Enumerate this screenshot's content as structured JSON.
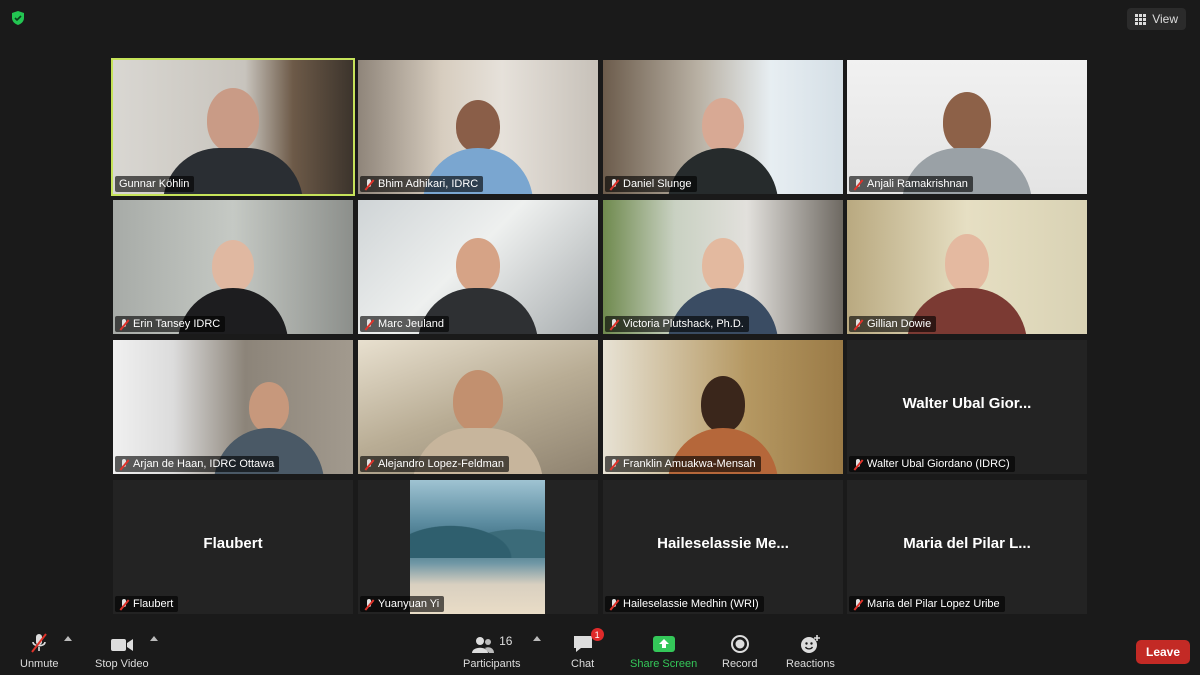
{
  "top": {
    "view_label": "View"
  },
  "tiles": [
    {
      "name": "Gunnar Köhlin",
      "muted": false,
      "video": true,
      "active": true
    },
    {
      "name": "Bhim Adhikari, IDRC",
      "muted": true,
      "video": true
    },
    {
      "name": "Daniel Slunge",
      "muted": true,
      "video": true
    },
    {
      "name": "Anjali Ramakrishnan",
      "muted": true,
      "video": true
    },
    {
      "name": "Erin Tansey IDRC",
      "muted": true,
      "video": true
    },
    {
      "name": "Marc Jeuland",
      "muted": true,
      "video": true
    },
    {
      "name": "Victoria Plutshack, Ph.D.",
      "muted": true,
      "video": true
    },
    {
      "name": "Gillian Dowie",
      "muted": true,
      "video": true
    },
    {
      "name": "Arjan de Haan, IDRC Ottawa",
      "muted": true,
      "video": true
    },
    {
      "name": "Alejandro Lopez-Feldman",
      "muted": true,
      "video": true
    },
    {
      "name": "Franklin Amuakwa-Mensah",
      "muted": true,
      "video": true
    },
    {
      "name": "Walter Ubal Giordano (IDRC)",
      "muted": true,
      "video": false,
      "display": "Walter Ubal Gior..."
    },
    {
      "name": "Flaubert",
      "muted": true,
      "video": false,
      "display": "Flaubert"
    },
    {
      "name": "Yuanyuan Yi",
      "muted": true,
      "video": false,
      "picture": true
    },
    {
      "name": "Haileselassie Medhin (WRI)",
      "muted": true,
      "video": false,
      "display": "Haileselassie Me..."
    },
    {
      "name": "Maria del Pilar Lopez Uribe",
      "muted": true,
      "video": false,
      "display": "Maria del Pilar L..."
    }
  ],
  "toolbar": {
    "unmute": "Unmute",
    "stop_video": "Stop Video",
    "participants": "Participants",
    "participants_count": "16",
    "chat": "Chat",
    "chat_badge": "1",
    "share_screen": "Share Screen",
    "record": "Record",
    "reactions": "Reactions",
    "leave": "Leave"
  },
  "colors": {
    "active_speaker": "#c6e35a",
    "leave": "#c32a25",
    "share": "#34c759"
  }
}
